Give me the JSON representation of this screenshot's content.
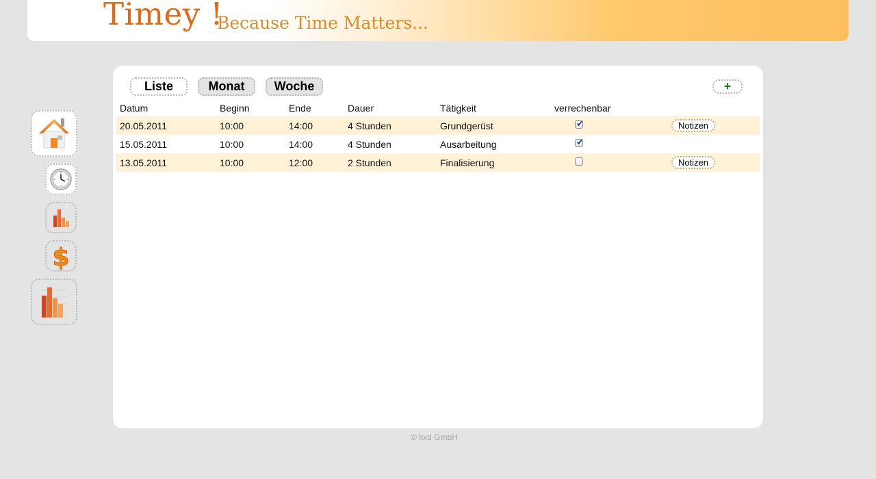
{
  "header": {
    "brand": "Timey !",
    "slogan": "Because Time Matters..."
  },
  "sidebar": {
    "items": [
      {
        "icon": "home-icon"
      },
      {
        "icon": "clock-icon"
      },
      {
        "icon": "bar-chart-icon"
      },
      {
        "icon": "dollar-icon"
      },
      {
        "icon": "report-chart-icon"
      }
    ]
  },
  "tabs": {
    "liste": "Liste",
    "monat": "Monat",
    "woche": "Woche"
  },
  "add_button": "+",
  "table": {
    "columns": [
      "Datum",
      "Beginn",
      "Ende",
      "Dauer",
      "Tätigkeit",
      "verrechenbar"
    ],
    "notes_label": "Notizen",
    "rows": [
      {
        "datum": "20.05.2011",
        "beginn": "10:00",
        "ende": "14:00",
        "dauer": "4 Stunden",
        "taetigkeit": "Grundgerüst",
        "verrechenbar": true,
        "has_notes": true
      },
      {
        "datum": "15.05.2011",
        "beginn": "10:00",
        "ende": "14:00",
        "dauer": "4 Stunden",
        "taetigkeit": "Ausarbeitung",
        "verrechenbar": true,
        "has_notes": false
      },
      {
        "datum": "13.05.2011",
        "beginn": "10:00",
        "ende": "12:00",
        "dauer": "2 Stunden",
        "taetigkeit": "Finalisierung",
        "verrechenbar": false,
        "has_notes": true
      }
    ]
  },
  "footer": "© Iixd GmbH",
  "colors": {
    "brand": "#e06a14",
    "slogan": "#df8c26",
    "row_highlight": "#fff2d6",
    "add_plus": "#1a8a1a",
    "check": "#1d3f82"
  }
}
